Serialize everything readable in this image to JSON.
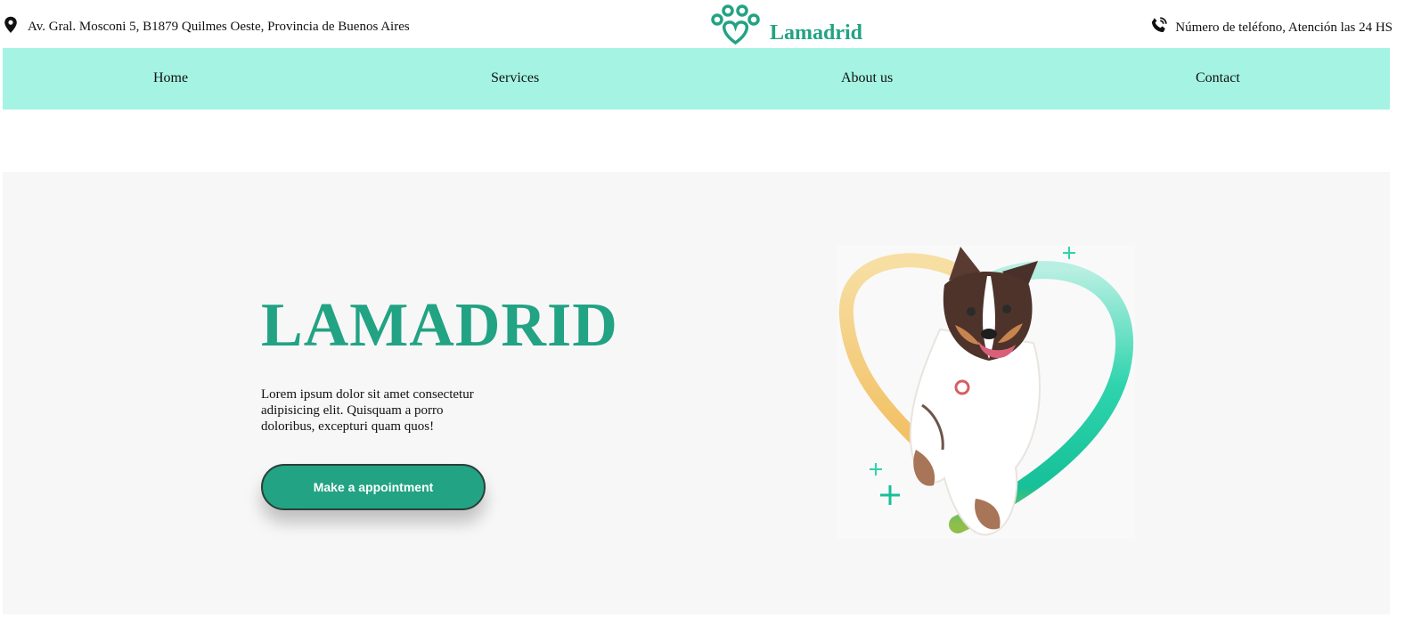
{
  "topbar": {
    "address": "Av. Gral. Mosconi 5, B1879 Quilmes Oeste,  Provincia de Buenos Aires",
    "address_icon": "map-pin-icon",
    "phone": "Número de teléfono, Atención las 24 HS",
    "phone_icon": "phone-icon",
    "brand_name": "Lamadrid",
    "brand_icon": "paw-heart-icon"
  },
  "nav": {
    "items": [
      {
        "label": "Home"
      },
      {
        "label": "Services"
      },
      {
        "label": "About us"
      },
      {
        "label": "Contact"
      }
    ],
    "background": "#a5f4e3"
  },
  "hero": {
    "title": "LAMADRID",
    "text": "Lorem ipsum dolor sit amet consectetur adipisicing elit. Quisquam a porro doloribus, excepturi quam quos!",
    "cta_label": "Make a appointment",
    "image": "dog-heart-illustration",
    "accent_color": "#22a383"
  }
}
